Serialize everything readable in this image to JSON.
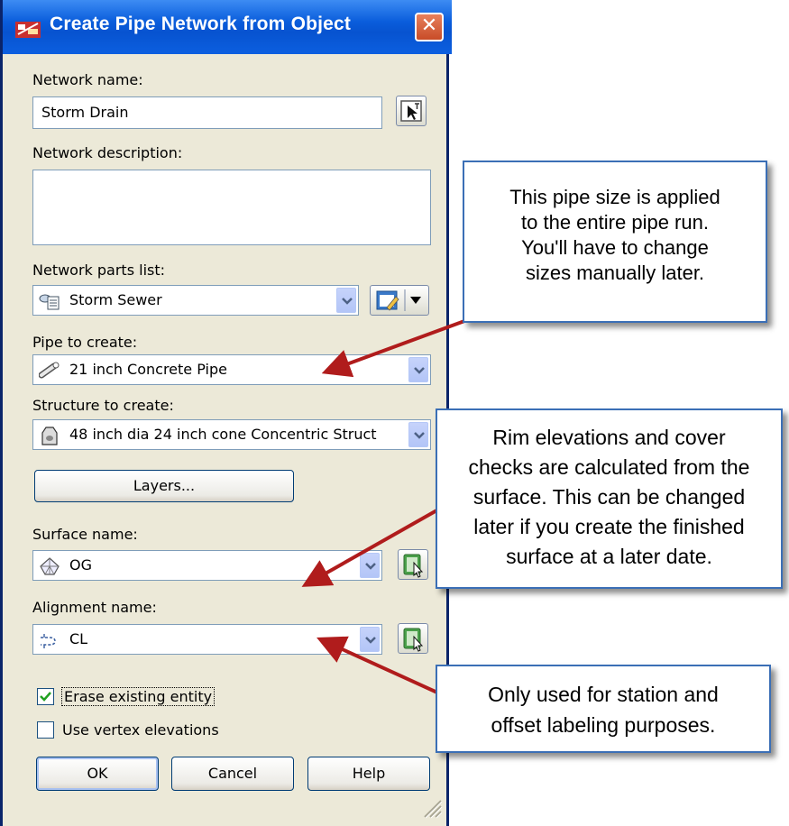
{
  "dialog": {
    "title": "Create Pipe Network from Object",
    "network_name_label": "Network name:",
    "network_name_value": "Storm Drain",
    "network_description_label": "Network description:",
    "network_description_value": "",
    "parts_list_label": "Network parts list:",
    "parts_list_value": "Storm Sewer",
    "pipe_label": "Pipe to create:",
    "pipe_value": "21 inch Concrete Pipe",
    "structure_label": "Structure to create:",
    "structure_value": "48 inch dia 24 inch cone Concentric Struct",
    "layers_button": "Layers...",
    "surface_label": "Surface name:",
    "surface_value": "OG",
    "alignment_label": "Alignment name:",
    "alignment_value": "CL",
    "erase_label": "Erase existing entity",
    "erase_checked": true,
    "vertex_label": "Use vertex elevations",
    "vertex_checked": false,
    "ok_button": "OK",
    "cancel_button": "Cancel",
    "help_button": "Help"
  },
  "callouts": {
    "pipe_size_lines": [
      "This pipe size is applied",
      "to the entire pipe run.",
      "You'll have to change",
      "sizes manually later."
    ],
    "rim_lines": [
      "Rim elevations and cover",
      "checks are calculated from the",
      "surface. This can be changed",
      "later if you create the finished",
      "surface at a later date."
    ],
    "alignment_lines": [
      "Only used for station and",
      "offset labeling purposes."
    ]
  },
  "colors": {
    "arrow": "#b01c1c",
    "callout_border": "#3b6fb6",
    "titlebar": "#0753d0"
  },
  "icons": [
    "pipe-network-app-icon",
    "close-icon",
    "pick-from-drawing-icon",
    "parts-list-icon",
    "edit-parts-list-icon",
    "pipe-icon",
    "structure-icon",
    "surface-icon",
    "alignment-icon",
    "select-surface-icon",
    "select-alignment-icon",
    "resize-grip-icon"
  ]
}
